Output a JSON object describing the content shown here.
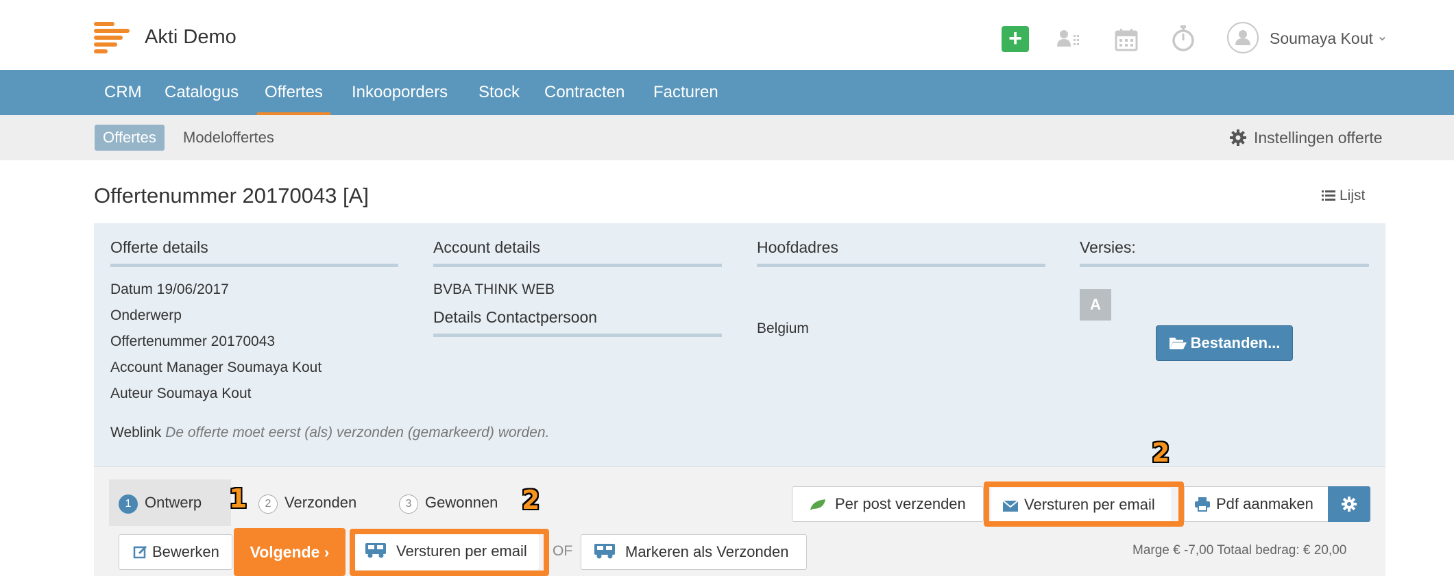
{
  "header": {
    "app_title": "Akti Demo",
    "user_name": "Soumaya Kout",
    "brand_color": "#f0892a",
    "icons": [
      "plus-icon",
      "contacts-grid-icon",
      "calendar-icon",
      "stopwatch-icon",
      "user-avatar-icon",
      "chevron-down-icon"
    ]
  },
  "main_nav": {
    "items": [
      {
        "label": "CRM"
      },
      {
        "label": "Catalogus"
      },
      {
        "label": "Offertes",
        "active": true
      },
      {
        "label": "Inkooporders"
      },
      {
        "label": "Stock"
      },
      {
        "label": "Contracten"
      },
      {
        "label": "Facturen"
      }
    ]
  },
  "sub_nav": {
    "active": "Offertes",
    "item": "Modeloffertes",
    "settings": "Instellingen offerte"
  },
  "page": {
    "title": "Offertenummer 20170043 [A]",
    "list_link": "Lijst"
  },
  "details": {
    "offerte": {
      "title": "Offerte details",
      "lines": [
        "Datum 19/06/2017",
        "Onderwerp",
        "Offertenummer 20170043",
        "Account Manager Soumaya Kout",
        "Auteur Soumaya Kout"
      ]
    },
    "account": {
      "title": "Account details",
      "company": "BVBA THINK WEB",
      "contact_title": "Details Contactpersoon"
    },
    "address": {
      "title": "Hoofdadres",
      "country": "Belgium"
    },
    "versions": {
      "title": "Versies:",
      "badge": "A",
      "files_button": "Bestanden..."
    },
    "weblink": {
      "label": "Weblink",
      "text": "De offerte moet eerst (als) verzonden (gemarkeerd) worden."
    }
  },
  "status": {
    "steps": [
      {
        "num": "1",
        "label": "Ontwerp",
        "active": true
      },
      {
        "num": "2",
        "label": "Verzonden"
      },
      {
        "num": "3",
        "label": "Gewonnen"
      }
    ],
    "callouts": [
      "1",
      "2",
      "2"
    ],
    "top_actions": {
      "post": "Per post verzenden",
      "email": "Versturen per email",
      "pdf": "Pdf aanmaken"
    },
    "bottom_actions": {
      "edit": "Bewerken",
      "next": "Volgende ›",
      "email": "Versturen per email",
      "or": "OF",
      "mark_sent": "Markeren als Verzonden"
    },
    "totals": "Marge € -7,00 Totaal bedrag: € 20,00",
    "highlight_color": "#f7862b"
  }
}
